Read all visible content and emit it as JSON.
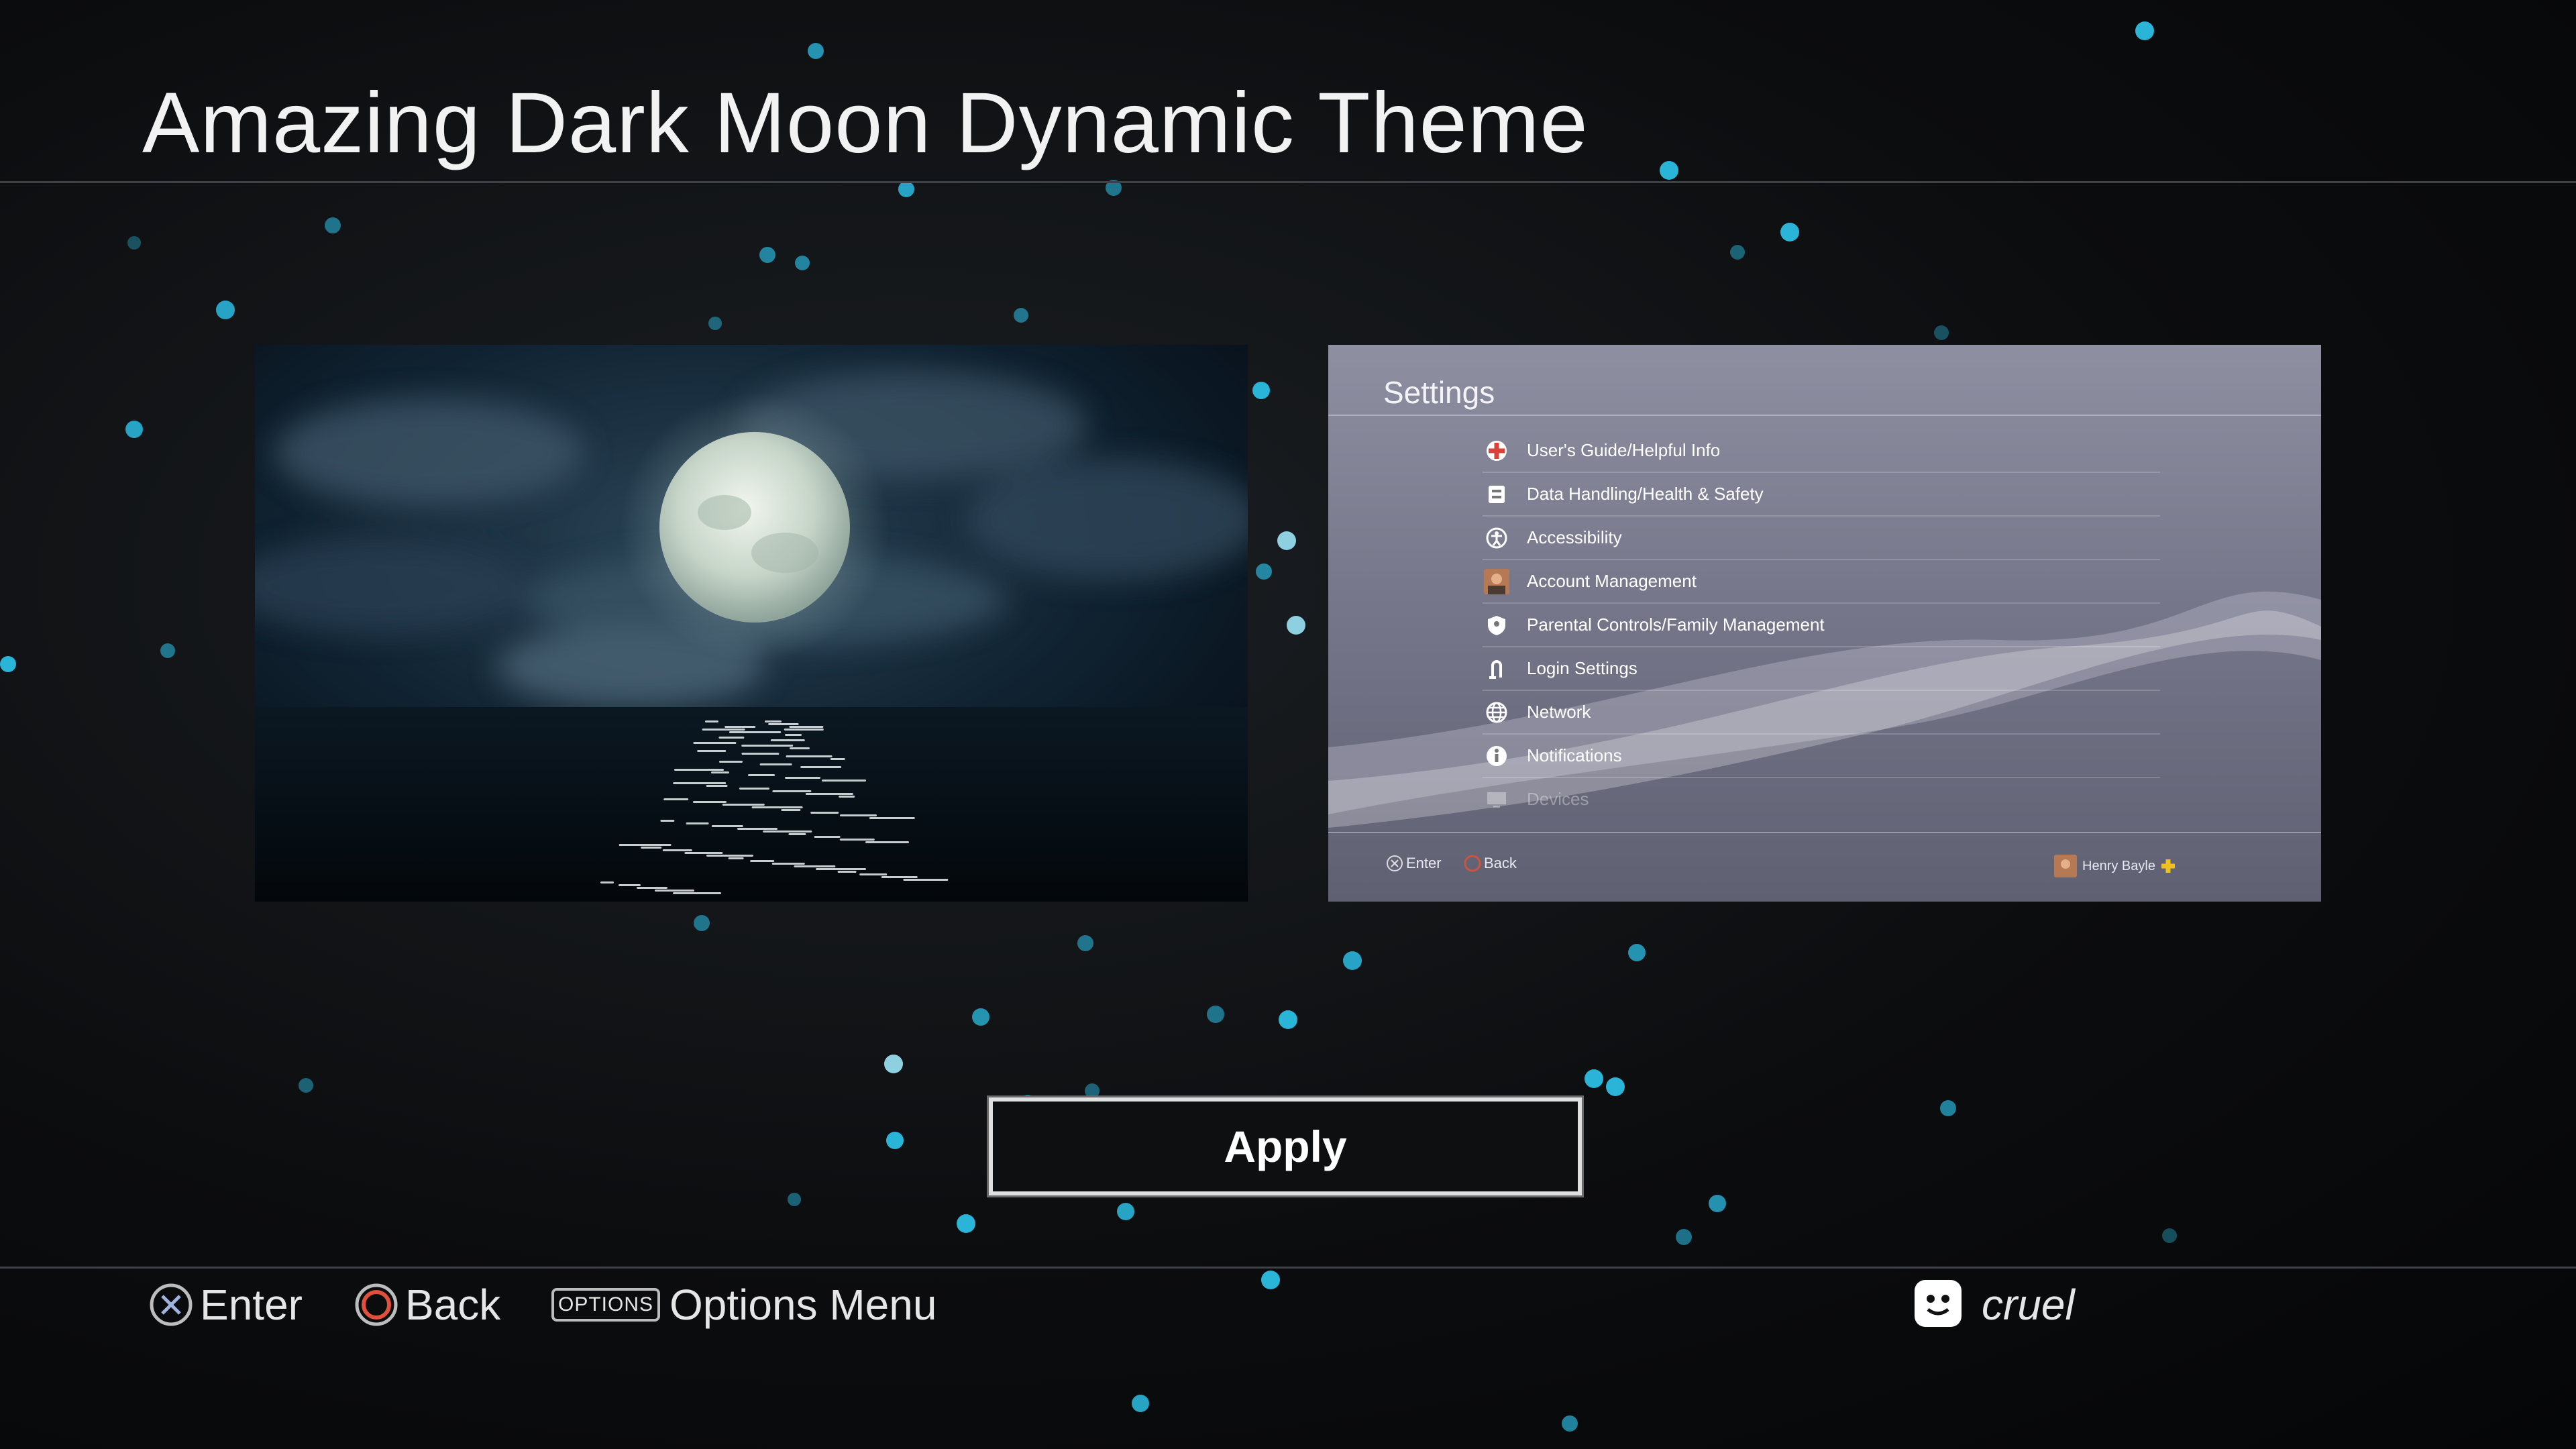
{
  "page": {
    "title": "Amazing Dark Moon Dynamic Theme"
  },
  "preview_right": {
    "title": "Settings",
    "items": [
      {
        "label": "User's Guide/Helpful Info",
        "icon": "help-icon"
      },
      {
        "label": "Data Handling/Health & Safety",
        "icon": "data-handling-icon"
      },
      {
        "label": "Accessibility",
        "icon": "accessibility-icon"
      },
      {
        "label": "Account Management",
        "icon": "account-avatar-icon"
      },
      {
        "label": "Parental Controls/Family Management",
        "icon": "parental-controls-icon"
      },
      {
        "label": "Login Settings",
        "icon": "login-icon"
      },
      {
        "label": "Network",
        "icon": "globe-icon"
      },
      {
        "label": "Notifications",
        "icon": "info-icon"
      },
      {
        "label": "Devices",
        "icon": "devices-icon"
      }
    ],
    "footer": {
      "enter": "Enter",
      "back": "Back",
      "user": "Henry Bayle"
    }
  },
  "apply_button": {
    "label": "Apply"
  },
  "hints": {
    "enter": "Enter",
    "back": "Back",
    "options_badge": "OPTIONS",
    "options": "Options Menu"
  },
  "user": {
    "name": "cruel"
  },
  "colors": {
    "particle": "#2ab4d8",
    "particle_light": "#8fd0e0",
    "background": "#0c0d0f"
  }
}
